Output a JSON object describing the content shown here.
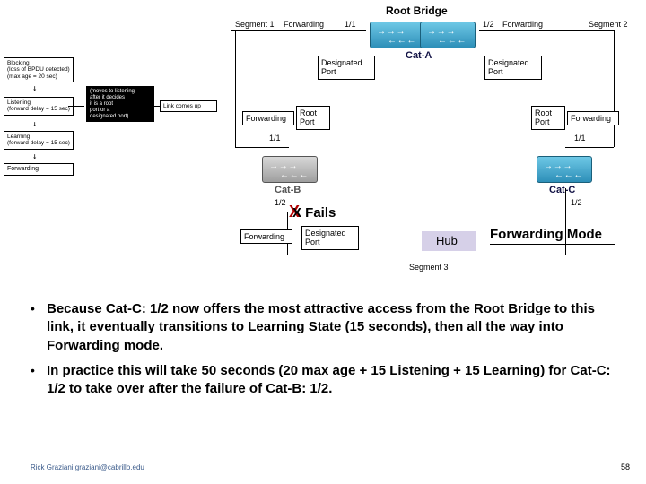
{
  "title": "Root Bridge",
  "topLabels": {
    "seg1": "Segment 1",
    "seg2": "Segment 2",
    "seg3": "Segment 3",
    "fwdL": "Forwarding",
    "fwdR": "Forwarding",
    "p11a": "1/1",
    "p12a": "1/2",
    "catA": "Cat-A",
    "desigL": "Designated\nPort",
    "desigR": "Designated\nPort"
  },
  "left": {
    "rootPort": "Root\nPort",
    "fwd": "Forwarding",
    "p11": "1/1",
    "catB": "Cat-B",
    "p12b": "1/2",
    "fwd2": "Forwarding",
    "desig": "Designated\nPort"
  },
  "right": {
    "rootPort": "Root\nPort",
    "fwd": "Forwarding",
    "p11": "1/1",
    "catC": "Cat-C",
    "p12c": "1/2"
  },
  "annot": {
    "xfails": "X Fails",
    "hub": "Hub",
    "fwdMode": "Forwarding Mode"
  },
  "states": {
    "s1": "Blocking\n(loss of BPDU detected)\n(max age = 20 sec)",
    "s2": "Listening\n(forward delay = 15 sec)",
    "s3": "Learning\n(forward delay = 15 sec)",
    "s4": "Forwarding",
    "boxA": "(moves to listening\nafter it decides\nit is a root\nport or a\ndesignated port)",
    "boxB": "Link comes up"
  },
  "bullets": [
    "Because Cat-C: 1/2 now offers the most attractive access from the Root Bridge to this link, it eventually transitions to Learning State (15 seconds), then all the way into Forwarding mode.",
    "In practice this will take 50 seconds (20 max age + 15 Listening + 15 Learning) for Cat-C: 1/2 to take over after the failure of Cat-B: 1/2."
  ],
  "footer": {
    "left": "Rick Graziani  graziani@cabrillo.edu",
    "right": "58"
  }
}
